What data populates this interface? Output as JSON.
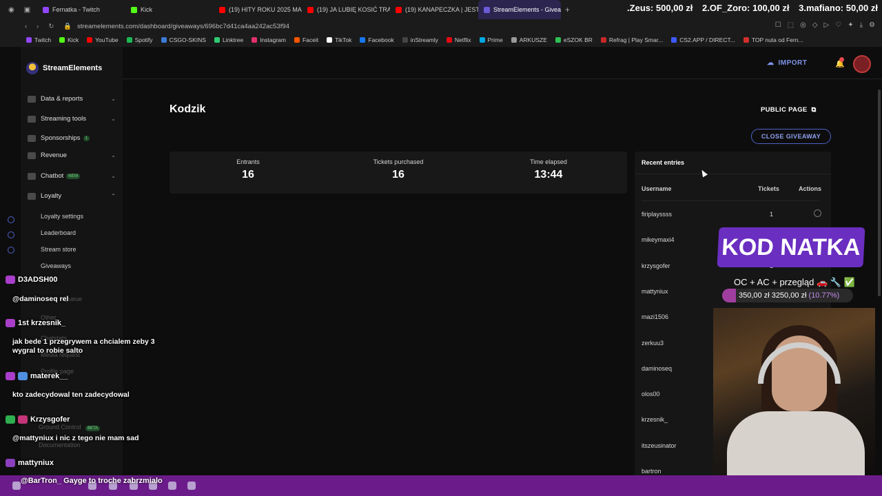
{
  "browser": {
    "tabs": [
      {
        "label": "Fernatka - Twitch",
        "color": "#9146ff"
      },
      {
        "label": "Kick",
        "color": "#53fc18"
      },
      {
        "label": "(19) HITY ROKU 2025 MA",
        "color": "#ff0000"
      },
      {
        "label": "(19) JA LUBIĘ KOSIĆ TRA",
        "color": "#ff0000"
      },
      {
        "label": "(19) KANAPECZKA | JEST",
        "color": "#ff0000"
      },
      {
        "label": "StreamElements - Giveaw",
        "color": "#6b5bd6",
        "active": true
      }
    ],
    "new_tab": "+",
    "url": "streamelements.com/dashboard/giveaways/696bc7d41ca4aa242ac53f94",
    "bookmarks": [
      "Twitch",
      "Kick",
      "YouTube",
      "Spotify",
      "CSGO-SKINS",
      "Linktree",
      "Instagram",
      "Faceit",
      "TikTok",
      "Facebook",
      "inStreamly",
      "Netflix",
      "Prime",
      "ARKUSZE",
      "eSZOK BR",
      "Refrag | Play Smar...",
      "CS2.APP / DIRECT...",
      "TOP nuta od Fern..."
    ]
  },
  "donations": [
    ".Zeus: 500,00 zł",
    "2.OF_Zoro: 100,00 zł",
    "3.mafiano: 50,00 zł"
  ],
  "sidebar": {
    "brand": "StreamElements",
    "items": [
      {
        "label": "Data & reports",
        "chev": "⌄"
      },
      {
        "label": "Streaming tools",
        "chev": "⌄"
      },
      {
        "label": "Sponsorships",
        "badge": "1"
      },
      {
        "label": "Revenue",
        "chev": "⌄"
      },
      {
        "label": "Chatbot",
        "badge": "NEW",
        "chev": "⌄"
      },
      {
        "label": "Loyalty",
        "chev": "⌃"
      }
    ],
    "loyalty_sub": [
      "Loyalty settings",
      "Leaderboard",
      "Stream store",
      "Giveaways"
    ],
    "hidden": [
      "Queue",
      "Other",
      "Chatstats",
      "Media request",
      "Profile page",
      "Ground Control",
      "Documentation"
    ],
    "ground_badge": "BETA"
  },
  "header": {
    "import_label": "IMPORT"
  },
  "page": {
    "title": "Kodzik",
    "public_page": "PUBLIC PAGE",
    "close_giveaway": "CLOSE GIVEAWAY",
    "stats": [
      {
        "label": "Entrants",
        "value": "16"
      },
      {
        "label": "Tickets purchased",
        "value": "16"
      },
      {
        "label": "Time elapsed",
        "value": "13:44"
      }
    ]
  },
  "recent": {
    "title": "Recent entries",
    "columns": [
      "Username",
      "Tickets",
      "Actions"
    ],
    "rows": [
      {
        "username": "firiplayssss",
        "tickets": "1"
      },
      {
        "username": "mikeymaxi4",
        "tickets": ""
      },
      {
        "username": "krzysgofer",
        "tickets": "1"
      },
      {
        "username": "mattyniux",
        "tickets": ""
      },
      {
        "username": "mazi1506",
        "tickets": ""
      },
      {
        "username": "zerkuu3",
        "tickets": ""
      },
      {
        "username": "daminoseq",
        "tickets": ""
      },
      {
        "username": "olos00",
        "tickets": ""
      },
      {
        "username": "krzesnik_",
        "tickets": ""
      },
      {
        "username": "itszeusinator",
        "tickets": ""
      },
      {
        "username": "bartron",
        "tickets": ""
      }
    ]
  },
  "overlay": {
    "kod": "KOD NATKA",
    "goal_label": "OC + AC + przegląd 🚗 🔧 ✅",
    "goal_text": "350,00 zł  3250,00 zł",
    "goal_pct": "(10.77%)",
    "goal_fraction": 0.1077
  },
  "chat": [
    {
      "user": "D3ADSH00",
      "msg": "@daminoseq rel"
    },
    {
      "user": "krzesnik_",
      "msg": "jak bede 1 przegrywem a chcialem zeby 3 wygral to robie salto"
    },
    {
      "user": "materek__",
      "msg": "kto zadecydowal ten zadecydowal"
    },
    {
      "user": "Krzysgofer",
      "msg": "@mattyniux i nic z tego nie mam sad"
    },
    {
      "user": "mattyniux",
      "msg": "@BarTron_ Gayge to troche zabrzmialo"
    }
  ],
  "chat_badge": "1st"
}
